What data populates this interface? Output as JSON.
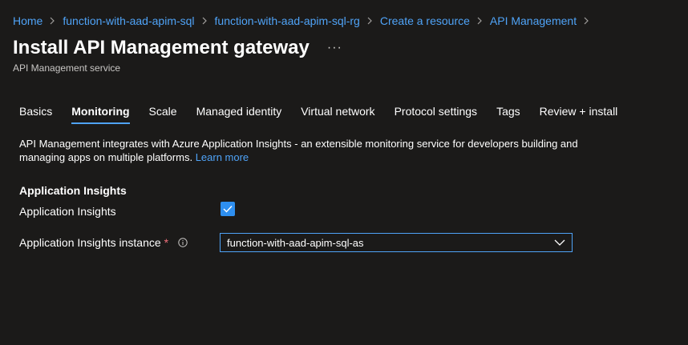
{
  "breadcrumb": [
    {
      "label": "Home"
    },
    {
      "label": "function-with-aad-apim-sql"
    },
    {
      "label": "function-with-aad-apim-sql-rg"
    },
    {
      "label": "Create a resource"
    },
    {
      "label": "API Management"
    }
  ],
  "header": {
    "title": "Install API Management gateway",
    "more": "···",
    "subtitle": "API Management service"
  },
  "tabs": [
    {
      "label": "Basics",
      "active": false
    },
    {
      "label": "Monitoring",
      "active": true
    },
    {
      "label": "Scale",
      "active": false
    },
    {
      "label": "Managed identity",
      "active": false
    },
    {
      "label": "Virtual network",
      "active": false
    },
    {
      "label": "Protocol settings",
      "active": false
    },
    {
      "label": "Tags",
      "active": false
    },
    {
      "label": "Review + install",
      "active": false
    }
  ],
  "description": {
    "text": "API Management integrates with Azure Application Insights - an extensible monitoring service for developers building and managing apps on multiple platforms.",
    "link": "Learn more"
  },
  "section": {
    "heading": "Application Insights"
  },
  "fields": {
    "app_insights_label": "Application Insights",
    "app_insights_checked": true,
    "instance_label": "Application Insights instance",
    "instance_required": "*",
    "instance_value": "function-with-aad-apim-sql-as"
  },
  "colors": {
    "accent": "#4fa3f7",
    "checkbox": "#2e8ff0",
    "background": "#1b1a19",
    "required": "#f1707b"
  }
}
